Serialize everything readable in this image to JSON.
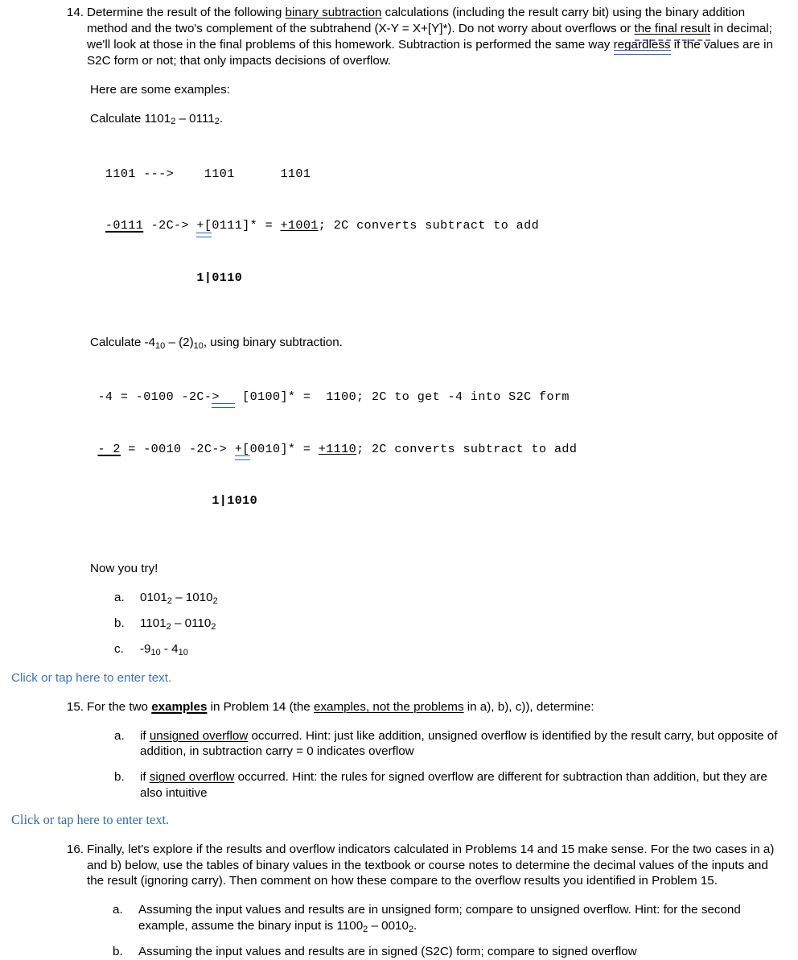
{
  "document": {
    "title": "Binary Subtraction Homework Problems 14-16"
  },
  "problem14": {
    "number": "14.",
    "text_part1": "Determine the result of the following ",
    "underlined1": "binary subtraction",
    "text_part2": " calculations (including the result carry bit) using the binary addition method and the two's complement of the subtrahend (X-Y = X+[Y]*). Do not worry about overflows or ",
    "underlined2": "the final result",
    "text_part3": " in decimal; we'll look at those in the final problems of this homework. Subtraction is performed the same way ",
    "underlined3": "regardless",
    "text_part4": " if the values are in S2C form or not; that only impacts decisions of overflow.",
    "examples_intro": "Here are some examples:",
    "example1": {
      "caption_pre": "Calculate 1101",
      "caption_sub1": "2",
      "caption_mid": " – 0111",
      "caption_sub2": "2",
      "caption_post": ".",
      "line1": "  1101 --->    1101      1101",
      "line2_a": "  ",
      "line2_minuend": "-0111",
      "line2_b": " -2C-> ",
      "line2_plusbracket": "+[",
      "line2_c": "0111]* = ",
      "line2_addend": "+1001",
      "line2_d": "; 2C converts subtract to add",
      "result": "              1|0110"
    },
    "example2": {
      "caption_pre": "Calculate -4",
      "caption_sub1": "10",
      "caption_mid": " – (2)",
      "caption_sub2": "10",
      "caption_post": ", using binary subtraction.",
      "line1_a": " -4 = -0100 -2C-",
      "line1_arrow": ">  ",
      "line1_b": " [0100]* =  1100; 2C to get -4 into S2C form",
      "line2_a": " ",
      "line2_minuend": "- 2",
      "line2_b": " = -0010 -2C-> ",
      "line2_plusbracket": "+[",
      "line2_c": "0010]* = ",
      "line2_addend": "+1110",
      "line2_d": "; 2C converts subtract to add",
      "result": "                1|1010"
    },
    "now_you_try": "Now you try!",
    "subitems": [
      {
        "letter": "a.",
        "pre": "0101",
        "sub1": "2",
        "mid": " – 1010",
        "sub2": "2",
        "post": ""
      },
      {
        "letter": "b.",
        "pre": "1101",
        "sub1": "2",
        "mid": " – 0110",
        "sub2": "2",
        "post": ""
      },
      {
        "letter": "c.",
        "pre": "-9",
        "sub1": "10",
        "mid": " - 4",
        "sub2": "10",
        "post": ""
      }
    ]
  },
  "placeholder1": "Click or tap here to enter text.",
  "problem15": {
    "number": "15.",
    "text_part1": "For the two ",
    "bold_underlined": "examples",
    "text_part2": " in Problem 14 (the ",
    "underlined": "examples, not the problems",
    "text_part3": " in a), b), c)), determine:",
    "subitems": [
      {
        "letter": "a.",
        "text_part1": "if ",
        "underlined": "unsigned overflow",
        "text_part2": " occurred. Hint: just like addition, unsigned overflow is identified by the result carry, but opposite of addition, in subtraction carry = 0 indicates overflow"
      },
      {
        "letter": "b.",
        "text_part1": "if ",
        "underlined": "signed overflow",
        "text_part2": " occurred. Hint: the rules for signed overflow are different for subtraction than addition, but they are also intuitive"
      }
    ]
  },
  "placeholder2": "Click or tap here to enter text.",
  "problem16": {
    "number": "16.",
    "text": "Finally, let's explore if the results and overflow indicators calculated in Problems 14 and 15 make sense. For the two cases in a) and b) below, use the tables of binary values in the textbook or course notes to determine the decimal values of the inputs and the result (ignoring carry). Then comment on how these compare to the overflow results you identified in Problem 15.",
    "subitems": [
      {
        "letter": "a.",
        "text_pre": "Assuming the input values and results are in unsigned form; compare to unsigned overflow. Hint: for the second example, assume the binary input is 1100",
        "sub1": "2",
        "text_mid": " – 0010",
        "sub2": "2",
        "text_post": "."
      },
      {
        "letter": "b.",
        "text_pre": "Assuming the input values and results are in signed (S2C) form; compare to signed overflow",
        "sub1": "",
        "text_mid": "",
        "sub2": "",
        "text_post": ""
      }
    ]
  },
  "colors": {
    "placeholder_blue": "#3b74bf",
    "grammar_underline_blue": "#2a5fc0",
    "smart_lookup_purple": "#7b68c8",
    "text_black": "#000000",
    "background": "#ffffff"
  }
}
